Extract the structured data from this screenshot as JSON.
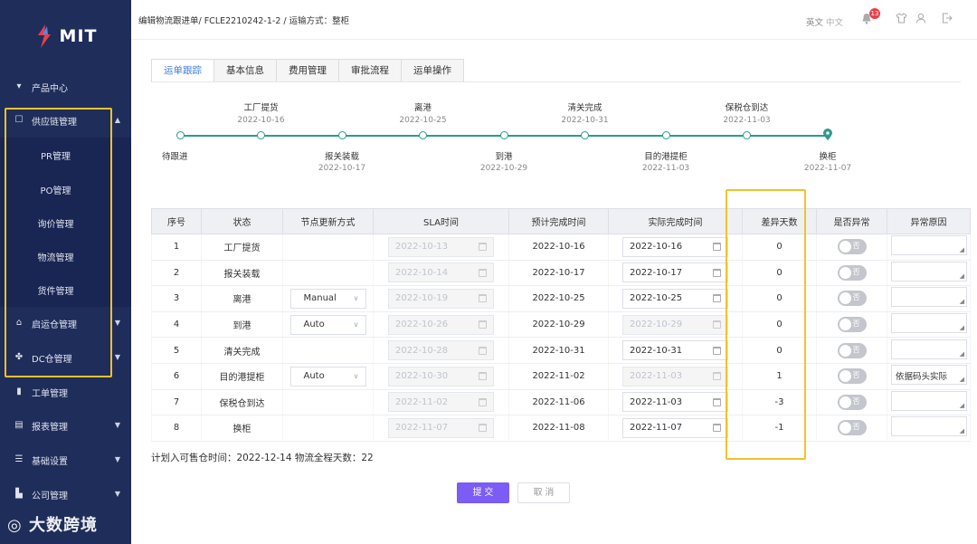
{
  "app": {
    "logo_text": "MIT"
  },
  "sidebar": {
    "items": [
      {
        "label": "产品中心",
        "icon": "tshirt-icon"
      },
      {
        "label": "供应链管理",
        "icon": "box-icon",
        "expanded": true
      },
      {
        "label": "启运仓管理",
        "icon": "ship-icon"
      },
      {
        "label": "DC仓管理",
        "icon": "warehouse-icon"
      },
      {
        "label": "工单管理",
        "icon": "clipboard-icon"
      },
      {
        "label": "报表管理",
        "icon": "chart-icon"
      },
      {
        "label": "基础设置",
        "icon": "settings-icon"
      },
      {
        "label": "公司管理",
        "icon": "building-icon"
      }
    ],
    "sub_items": [
      "PR管理",
      "PO管理",
      "询价管理",
      "物流管理",
      "货件管理"
    ]
  },
  "watermark": "大数跨境",
  "header": {
    "breadcrumb": "编辑物流跟进单/ FCLE2210242-1-2 / 运输方式：整柜",
    "lang_en": "英文",
    "lang_zh": "中文",
    "notification_count": "13"
  },
  "tabs": [
    "运单跟踪",
    "基本信息",
    "费用管理",
    "审批流程",
    "运单操作"
  ],
  "timeline": {
    "nodes": [
      {
        "label": "待跟进",
        "date": "",
        "pos": "bottom"
      },
      {
        "label": "工厂提货",
        "date": "2022-10-16",
        "pos": "top"
      },
      {
        "label": "报关装载",
        "date": "2022-10-17",
        "pos": "bottom"
      },
      {
        "label": "离港",
        "date": "2022-10-25",
        "pos": "top"
      },
      {
        "label": "到港",
        "date": "2022-10-29",
        "pos": "bottom"
      },
      {
        "label": "清关完成",
        "date": "2022-10-31",
        "pos": "top"
      },
      {
        "label": "目的港提柜",
        "date": "2022-11-03",
        "pos": "bottom"
      },
      {
        "label": "保税仓到达",
        "date": "2022-11-03",
        "pos": "top"
      },
      {
        "label": "换柜",
        "date": "2022-11-07",
        "pos": "bottom"
      }
    ]
  },
  "table": {
    "headers": [
      "序号",
      "状态",
      "节点更新方式",
      "SLA时间",
      "预计完成时间",
      "实际完成时间",
      "差异天数",
      "是否异常",
      "异常原因"
    ],
    "rows": [
      {
        "no": "1",
        "status": "工厂提货",
        "method": "",
        "sla": "2022-10-13",
        "planned": "2022-10-16",
        "actual": "2022-10-16",
        "actual_disabled": false,
        "diff": "0",
        "diff_red": false,
        "abnormal": "否",
        "reason": ""
      },
      {
        "no": "2",
        "status": "报关装载",
        "method": "",
        "sla": "2022-10-14",
        "planned": "2022-10-17",
        "actual": "2022-10-17",
        "actual_disabled": false,
        "diff": "0",
        "diff_red": false,
        "abnormal": "否",
        "reason": ""
      },
      {
        "no": "3",
        "status": "离港",
        "method": "Manual",
        "sla": "2022-10-19",
        "planned": "2022-10-25",
        "actual": "2022-10-25",
        "actual_disabled": false,
        "diff": "0",
        "diff_red": false,
        "abnormal": "否",
        "reason": ""
      },
      {
        "no": "4",
        "status": "到港",
        "method": "Auto",
        "sla": "2022-10-26",
        "planned": "2022-10-29",
        "actual": "2022-10-29",
        "actual_disabled": true,
        "diff": "0",
        "diff_red": false,
        "abnormal": "否",
        "reason": ""
      },
      {
        "no": "5",
        "status": "清关完成",
        "method": "",
        "sla": "2022-10-28",
        "planned": "2022-10-31",
        "actual": "2022-10-31",
        "actual_disabled": false,
        "diff": "0",
        "diff_red": false,
        "abnormal": "否",
        "reason": ""
      },
      {
        "no": "6",
        "status": "目的港提柜",
        "method": "Auto",
        "sla": "2022-10-30",
        "planned": "2022-11-02",
        "actual": "2022-11-03",
        "actual_disabled": true,
        "diff": "1",
        "diff_red": true,
        "abnormal": "否",
        "reason": "依据码头实际"
      },
      {
        "no": "7",
        "status": "保税仓到达",
        "method": "",
        "sla": "2022-11-02",
        "planned": "2022-11-06",
        "actual": "2022-11-03",
        "actual_disabled": false,
        "diff": "-3",
        "diff_red": false,
        "abnormal": "否",
        "reason": ""
      },
      {
        "no": "8",
        "status": "换柜",
        "method": "",
        "sla": "2022-11-07",
        "planned": "2022-11-08",
        "actual": "2022-11-07",
        "actual_disabled": false,
        "diff": "-1",
        "diff_red": false,
        "abnormal": "否",
        "reason": ""
      }
    ]
  },
  "summary": "计划入可售仓时间：2022-12-14   物流全程天数：22",
  "buttons": {
    "submit": "提 交",
    "cancel": "取 消"
  },
  "colors": {
    "sidebar_bg": "#1f2d5a",
    "accent": "#7b5cf5",
    "timeline": "#2c9b8d",
    "highlight": "#f2c12e",
    "tab_active": "#3f7be0"
  }
}
